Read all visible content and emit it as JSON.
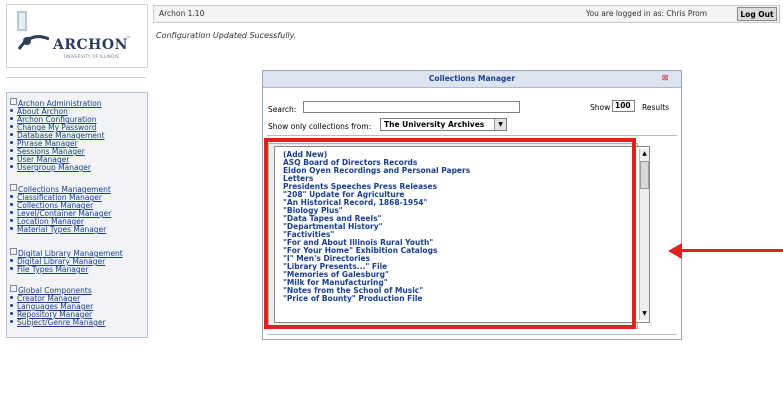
{
  "logo": {
    "text": "ARCHON",
    "tm": "™",
    "subtext": "UNIVERSITY OF ILLINOIS"
  },
  "header": {
    "version": "Archon 1.10",
    "logged_in": "You are logged in as: Chris Prom",
    "logout_label": "Log Out"
  },
  "message": "Configuration Updated Sucessfully.",
  "sidebar": {
    "sections": [
      {
        "title": "Archon Administration",
        "items": [
          "About Archon",
          "Archon Configuration",
          "Change My Password",
          "Database Management",
          "Phrase Manager",
          "Sessions Manager",
          "User Manager",
          "Usergroup Manager"
        ]
      },
      {
        "title": "Collections Management",
        "items": [
          "Classification Manager",
          "Collections Manager",
          "Level/Container Manager",
          "Location Manager",
          "Material Types Manager"
        ]
      },
      {
        "title": "Digital Library Management",
        "items": [
          "Digital Library Manager",
          "File Types Manager"
        ]
      },
      {
        "title": "Global Components",
        "items": [
          "Creator Manager",
          "Languages Manager",
          "Repository Manager",
          "Subject/Genre Manager"
        ]
      }
    ]
  },
  "dialog": {
    "title": "Collections Manager",
    "close_icon": "⊠",
    "search_label": "Search:",
    "search_value": "",
    "show_label": "Show",
    "show_value": "100",
    "results_label": "Results",
    "filter_label": "Show only collections from:",
    "filter_value": "The University Archives",
    "scroll_up": "▲",
    "scroll_down": "▼",
    "caret": "▼",
    "items": [
      "(Add New)",
      "ASQ Board of Directors Records",
      "Eldon Oyen Recordings and Personal Papers",
      "Letters",
      "Presidents Speeches Press Releases",
      "\"208\" Update for Agriculture",
      "\"An Historical Record, 1868-1954\"",
      "\"Biology Plus\"",
      "\"Data Tapes and Reels\"",
      "\"Departmental History\"",
      "\"Factivities\"",
      "\"For and About Illinois Rural Youth\"",
      "\"For Your Home\" Exhibition Catalogs",
      "\"I\" Men's Directories",
      "\"Library Presents...\" File",
      "\"Memories of Galesburg\"",
      "\"Milk for Manufacturing\"",
      "\"Notes from the School of Music\"",
      "\"Price of Bounty\" Production File"
    ]
  },
  "annotation": {
    "color": "#e41f1f"
  }
}
